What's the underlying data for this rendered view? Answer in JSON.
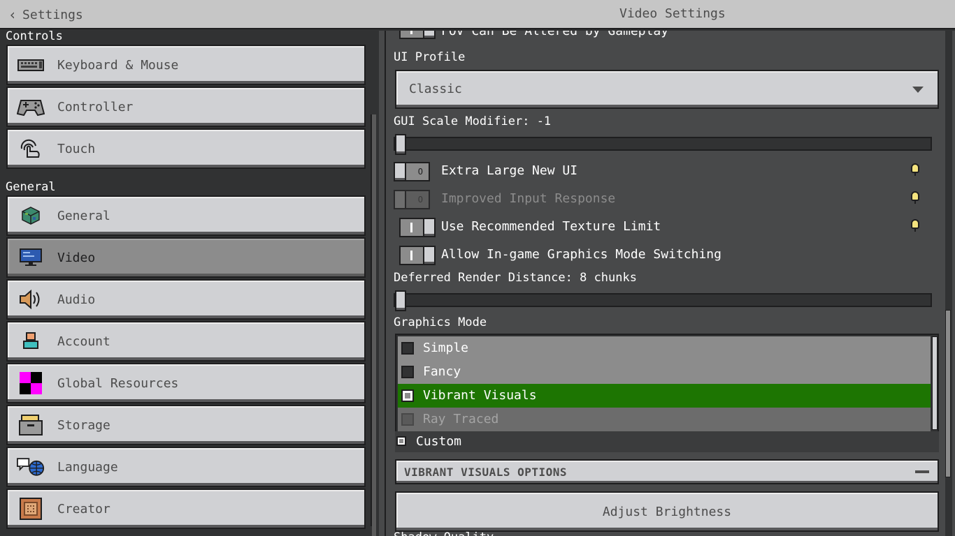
{
  "topbar": {
    "back_label": "Settings",
    "title": "Video Settings"
  },
  "sidebar": {
    "sections": [
      {
        "label": "Controls",
        "items": [
          {
            "label": "Keyboard & Mouse",
            "icon": "keyboard-icon"
          },
          {
            "label": "Controller",
            "icon": "controller-icon"
          },
          {
            "label": "Touch",
            "icon": "touch-icon"
          }
        ]
      },
      {
        "label": "General",
        "items": [
          {
            "label": "General",
            "icon": "globe-cube-icon"
          },
          {
            "label": "Video",
            "icon": "monitor-icon",
            "active": true
          },
          {
            "label": "Audio",
            "icon": "speaker-icon"
          },
          {
            "label": "Account",
            "icon": "account-icon"
          },
          {
            "label": "Global Resources",
            "icon": "checker-pack-icon"
          },
          {
            "label": "Storage",
            "icon": "storage-box-icon"
          },
          {
            "label": "Language",
            "icon": "language-icon"
          },
          {
            "label": "Creator",
            "icon": "creator-icon"
          }
        ]
      }
    ]
  },
  "main": {
    "cut_top_label": "FOV Can Be Altered by Gameplay",
    "ui_profile": {
      "label": "UI Profile",
      "value": "Classic"
    },
    "gui_scale": {
      "label": "GUI Scale Modifier: -1",
      "value_fraction": 0.0
    },
    "toggles": [
      {
        "label": "Extra Large New UI",
        "on": false,
        "disabled": false,
        "info": true
      },
      {
        "label": "Improved Input Response",
        "on": false,
        "disabled": true,
        "info": true
      },
      {
        "label": "Use Recommended Texture Limit",
        "on": true,
        "disabled": false,
        "info": true
      },
      {
        "label": "Allow In-game Graphics Mode Switching",
        "on": true,
        "disabled": false,
        "info": false
      }
    ],
    "render_distance": {
      "label": "Deferred Render Distance: 8 chunks",
      "value_fraction": 0.0
    },
    "graphics_mode": {
      "label": "Graphics Mode",
      "options": [
        {
          "label": "Simple",
          "state": "normal"
        },
        {
          "label": "Fancy",
          "state": "normal"
        },
        {
          "label": "Vibrant Visuals",
          "state": "selected"
        },
        {
          "label": "Ray Traced",
          "state": "disabled"
        }
      ],
      "custom_label": "Custom"
    },
    "vv_options": {
      "title": "VIBRANT VISUALS OPTIONS"
    },
    "adjust_brightness": "Adjust Brightness",
    "cut_bottom_label": "Shadow Quality"
  },
  "colors": {
    "selected_green": "#1d7502",
    "button_gray": "#d0d1d4",
    "panel_dark": "#313233",
    "panel_mid": "#48494a"
  }
}
